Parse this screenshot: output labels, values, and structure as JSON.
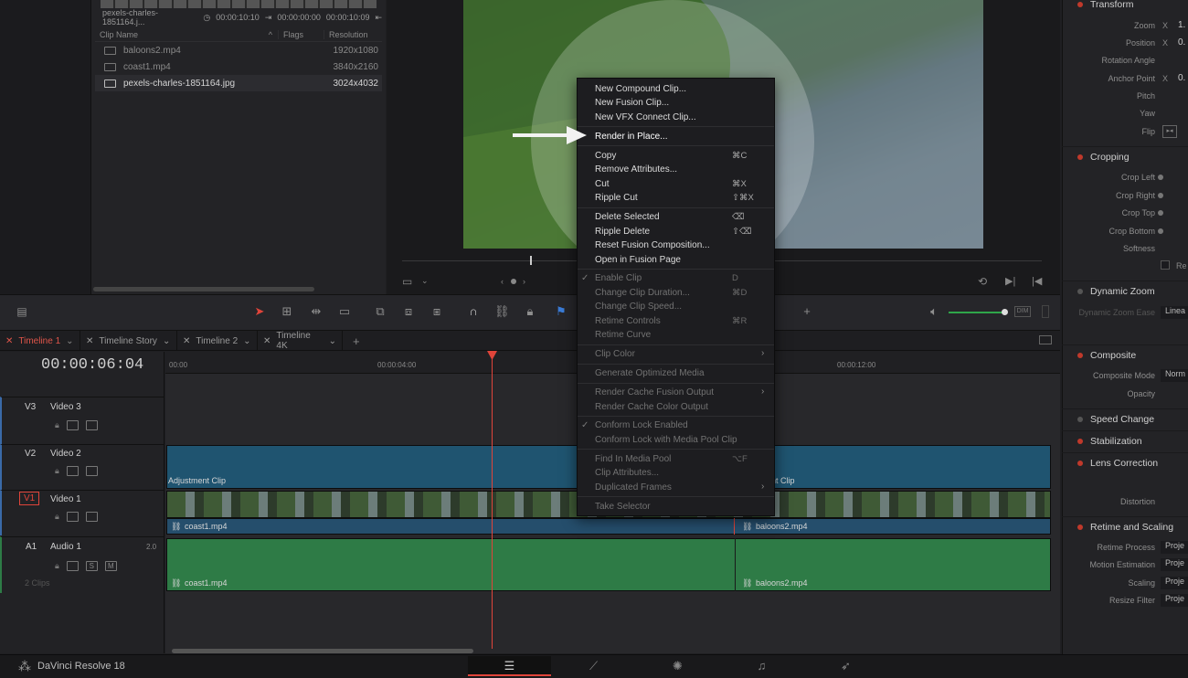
{
  "media_pool": {
    "clip_info": {
      "name": "pexels-charles-1851164.j...",
      "duration": "00:00:10:10",
      "in": "00:00:00:00",
      "out": "00:00:10:09"
    },
    "columns": {
      "name": "Clip Name",
      "flags": "Flags",
      "resolution": "Resolution"
    },
    "clips": [
      {
        "name": "baloons2.mp4",
        "resolution": "1920x1080"
      },
      {
        "name": "coast1.mp4",
        "resolution": "3840x2160"
      },
      {
        "name": "pexels-charles-1851164.jpg",
        "resolution": "3024x4032"
      }
    ]
  },
  "context_menu": {
    "items": [
      {
        "label": "New Compound Clip...",
        "shortcut": ""
      },
      {
        "label": "New Fusion Clip...",
        "shortcut": ""
      },
      {
        "label": "New VFX Connect Clip...",
        "shortcut": ""
      },
      {
        "label": "Render in Place...",
        "shortcut": ""
      },
      {
        "label": "Copy",
        "shortcut": "⌘C"
      },
      {
        "label": "Remove Attributes...",
        "shortcut": ""
      },
      {
        "label": "Cut",
        "shortcut": "⌘X"
      },
      {
        "label": "Ripple Cut",
        "shortcut": "⇧⌘X"
      },
      {
        "label": "Delete Selected",
        "shortcut": "⌫"
      },
      {
        "label": "Ripple Delete",
        "shortcut": "⇧⌫"
      },
      {
        "label": "Reset Fusion Composition...",
        "shortcut": ""
      },
      {
        "label": "Open in Fusion Page",
        "shortcut": ""
      },
      {
        "label": "Enable Clip",
        "shortcut": "D"
      },
      {
        "label": "Change Clip Duration...",
        "shortcut": "⌘D"
      },
      {
        "label": "Change Clip Speed...",
        "shortcut": ""
      },
      {
        "label": "Retime Controls",
        "shortcut": "⌘R"
      },
      {
        "label": "Retime Curve",
        "shortcut": ""
      },
      {
        "label": "Clip Color",
        "shortcut": ""
      },
      {
        "label": "Generate Optimized Media",
        "shortcut": ""
      },
      {
        "label": "Render Cache Fusion Output",
        "shortcut": ""
      },
      {
        "label": "Render Cache Color Output",
        "shortcut": ""
      },
      {
        "label": "Conform Lock Enabled",
        "shortcut": ""
      },
      {
        "label": "Conform Lock with Media Pool Clip",
        "shortcut": ""
      },
      {
        "label": "Find In Media Pool",
        "shortcut": "⌥F"
      },
      {
        "label": "Clip Attributes...",
        "shortcut": ""
      },
      {
        "label": "Duplicated Frames",
        "shortcut": ""
      },
      {
        "label": "Take Selector",
        "shortcut": ""
      }
    ]
  },
  "timeline": {
    "tabs": [
      "Timeline 1",
      "Timeline Story",
      "Timeline 2",
      "Timeline 4K"
    ],
    "timecode": "00:00:06:04",
    "ruler": [
      "00:00",
      "00:00:04:00",
      "00:00:12:00"
    ],
    "tracks": [
      {
        "id": "V3",
        "name": "Video 3"
      },
      {
        "id": "V2",
        "name": "Video 2"
      },
      {
        "id": "V1",
        "name": "Video 1"
      },
      {
        "id": "A1",
        "name": "Audio 1",
        "level": "2.0",
        "clips_count": "2 Clips",
        "solo": "S",
        "mute": "M"
      }
    ],
    "clips": {
      "adjustment_left": "Adjustment Clip",
      "adjustment_right": "nt Clip",
      "v1_left": "coast1.mp4",
      "v1_right": "baloons2.mp4",
      "a1_left": "coast1.mp4",
      "a1_right": "baloons2.mp4"
    }
  },
  "inspector": {
    "transform": {
      "title": "Transform",
      "zoom": "Zoom",
      "position": "Position",
      "rotation": "Rotation Angle",
      "anchor": "Anchor Point",
      "pitch": "Pitch",
      "yaw": "Yaw",
      "flip": "Flip",
      "x": "X",
      "zoom_val": "1.",
      "pos_val": "0.",
      "anchor_val": "0."
    },
    "cropping": {
      "title": "Cropping",
      "left": "Crop Left",
      "right": "Crop Right",
      "top": "Crop Top",
      "bottom": "Crop Bottom",
      "softness": "Softness",
      "retain": "Re"
    },
    "dynamic_zoom": {
      "title": "Dynamic Zoom",
      "ease": "Dynamic Zoom Ease",
      "ease_val": "Linea"
    },
    "composite": {
      "title": "Composite",
      "mode": "Composite Mode",
      "mode_val": "Norm",
      "opacity": "Opacity"
    },
    "speed_change": "Speed Change",
    "stabilization": "Stabilization",
    "lens_correction": {
      "title": "Lens Correction",
      "distortion": "Distortion"
    },
    "retime": {
      "title": "Retime and Scaling",
      "process": "Retime Process",
      "motion": "Motion Estimation",
      "scaling": "Scaling",
      "resize": "Resize Filter",
      "val": "Proje"
    }
  },
  "bottom": {
    "app_name": "DaVinci Resolve 18"
  },
  "toolbar": {
    "dim": "DIM"
  },
  "colors": {
    "accent": "#e0443a",
    "video_clip": "#1f5470",
    "audio_clip": "#2e7b46"
  }
}
